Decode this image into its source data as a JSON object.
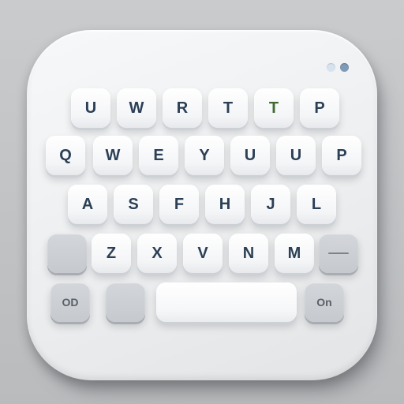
{
  "rows": {
    "row1": [
      "U",
      "W",
      "R",
      "T",
      "T",
      "P"
    ],
    "row2": [
      "Q",
      "W",
      "E",
      "Y",
      "U",
      "U",
      "P"
    ],
    "row3": [
      "A",
      "S",
      "F",
      "H",
      "J",
      "L"
    ],
    "row4": [
      "Z",
      "X",
      "V",
      "N",
      "M"
    ]
  },
  "bottom": {
    "left_label": "OD",
    "right_label": "On"
  },
  "icons": {
    "window_dots": "two-dots-icon",
    "dash_key": "minus-icon"
  },
  "colors": {
    "key_text": "#2b3f55",
    "accent_key_text": "#3f6b2f",
    "dot_light": "#d6e3ef",
    "dot_dark": "#7f9bb8"
  }
}
